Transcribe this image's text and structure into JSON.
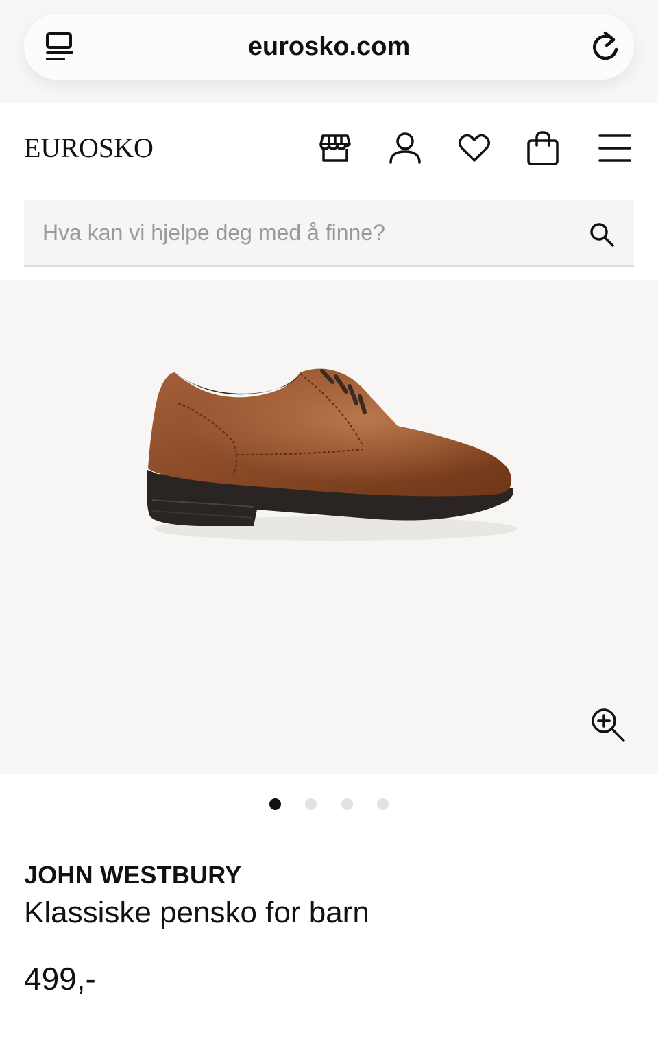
{
  "browser": {
    "url": "eurosko.com",
    "icons": {
      "left": "tabs-icon",
      "right": "reload-icon"
    }
  },
  "header": {
    "logo_text": "EUROSKO",
    "icons": [
      "store-icon",
      "account-icon",
      "heart-icon",
      "shopping-bag-icon",
      "menu-icon"
    ]
  },
  "search": {
    "placeholder": "Hva kan vi hjelpe deg med å finne?",
    "value": "",
    "icon": "search-icon"
  },
  "gallery": {
    "image": "brown-leather-shoe",
    "slide_count": 4,
    "active_slide": 1,
    "zoom_icon": "zoom-in-icon"
  },
  "product": {
    "brand": "JOHN WESTBURY",
    "title": "Klassiske pensko for barn",
    "price": "499,-"
  }
}
